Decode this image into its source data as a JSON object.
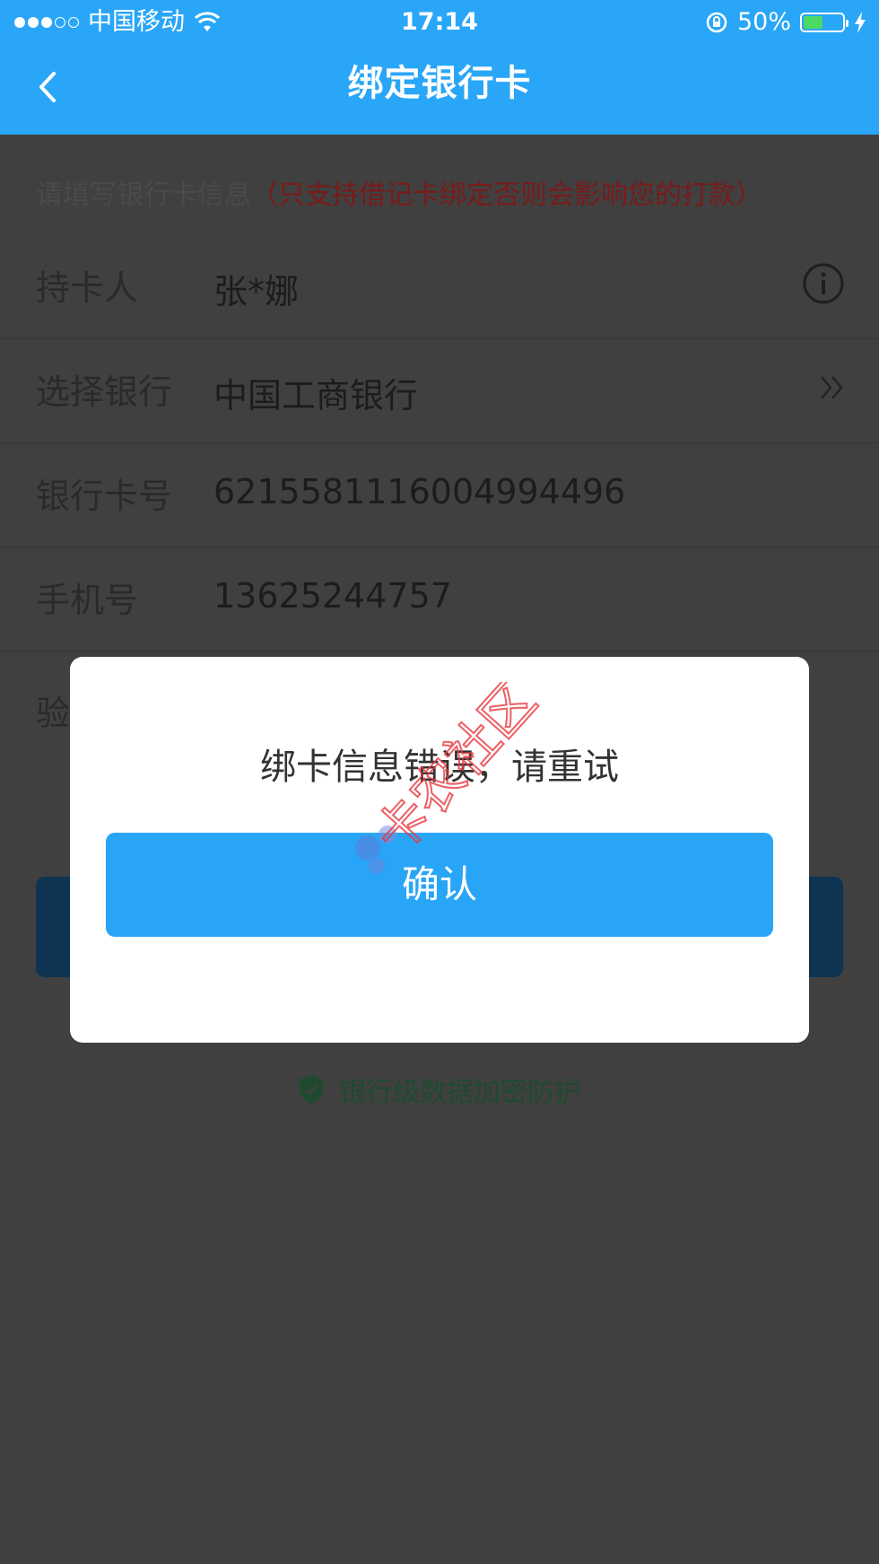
{
  "status_bar": {
    "carrier": "中国移动",
    "time": "17:14",
    "battery_percent": "50%",
    "battery_level": 0.5
  },
  "nav": {
    "title": "绑定银行卡"
  },
  "form": {
    "hint_prefix": "请填写银行卡信息",
    "hint_warning": "（只支持借记卡绑定否则会影响您的打款）",
    "rows": [
      {
        "label": "持卡人",
        "value": "张*娜"
      },
      {
        "label": "选择银行",
        "value": "中国工商银行"
      },
      {
        "label": "银行卡号",
        "value": "6215581116004994496"
      },
      {
        "label": "手机号",
        "value": "13625244757"
      },
      {
        "label": "验",
        "value": ""
      }
    ],
    "secure_text": "银行级数据加密防护"
  },
  "dialog": {
    "message": "绑卡信息错误，请重试",
    "confirm_label": "确认"
  },
  "watermark": {
    "text": "卡农社区"
  },
  "colors": {
    "nav_bg": "#2aa6f8",
    "confirm_bg": "#29a5f7",
    "warning": "#7a1a1a",
    "watermark": "#e8383d"
  }
}
